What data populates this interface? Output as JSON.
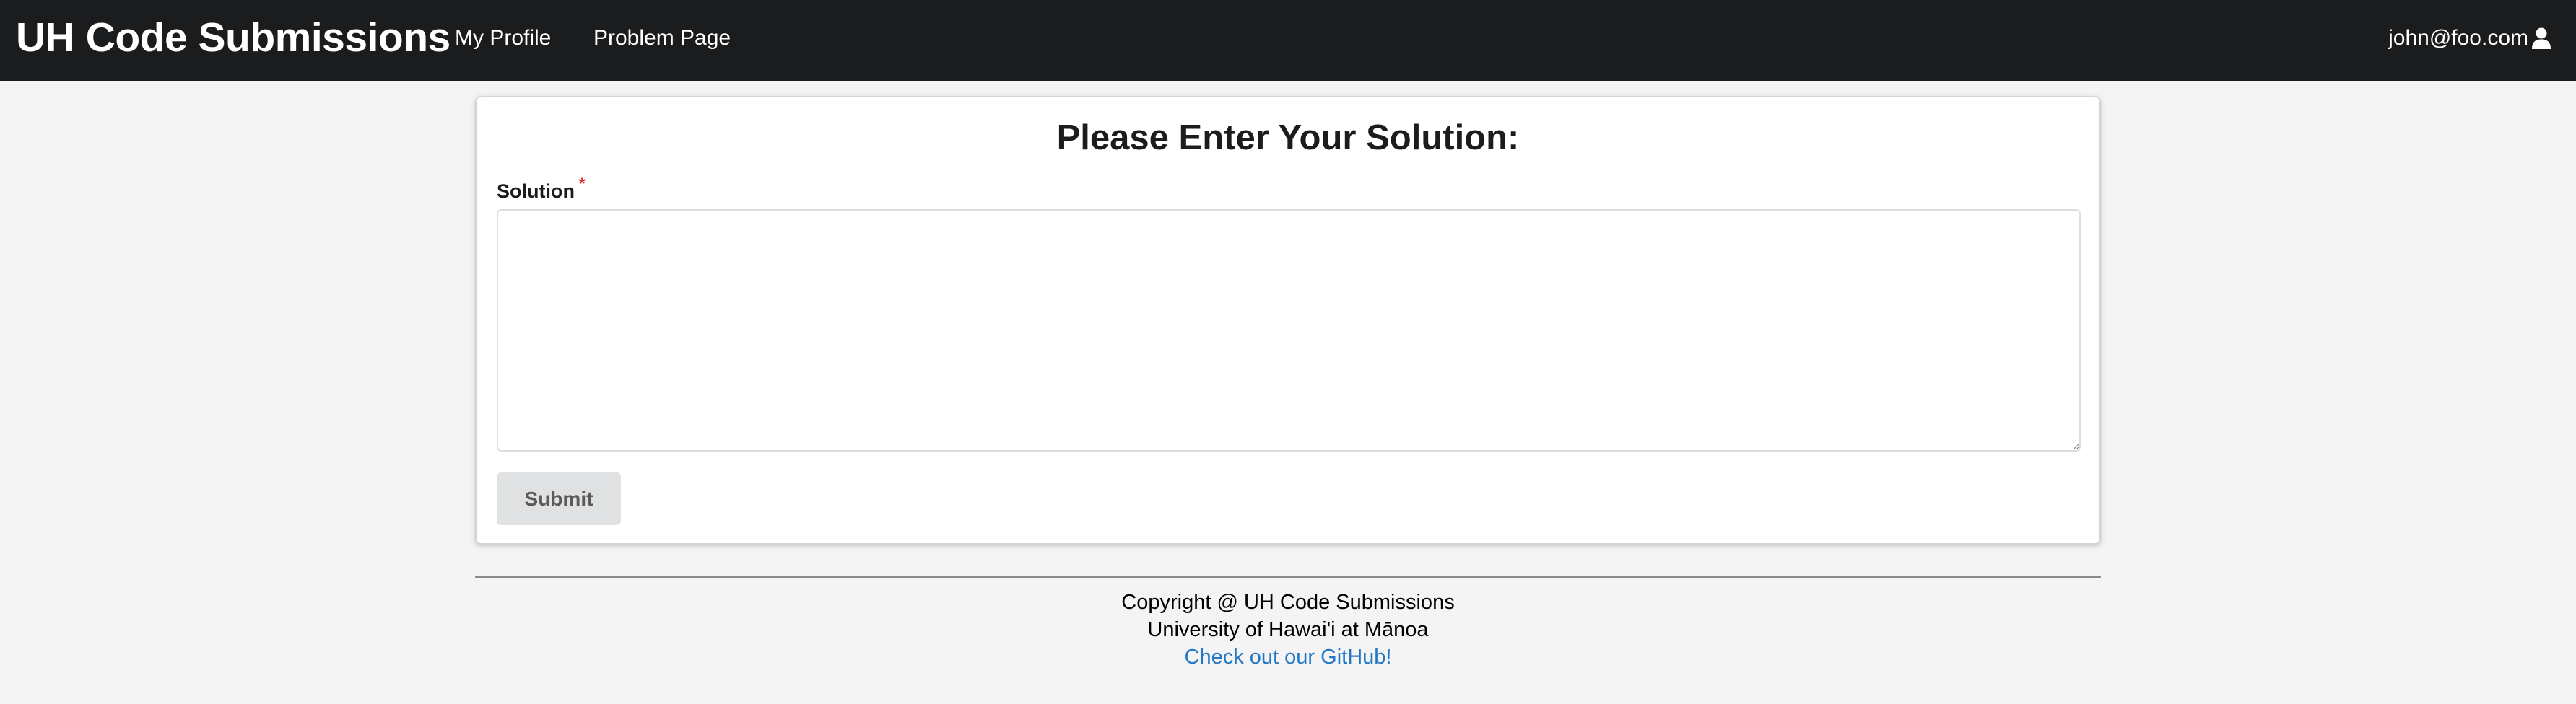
{
  "navbar": {
    "brand": "UH Code Submissions",
    "links": [
      {
        "label": "My Profile"
      },
      {
        "label": "Problem Page"
      }
    ],
    "user": {
      "email": "john@foo.com",
      "icon": "user-icon"
    }
  },
  "form": {
    "title": "Please Enter Your Solution:",
    "solution_label": "Solution",
    "required_marker": "*",
    "solution_value": "",
    "submit_label": "Submit"
  },
  "footer": {
    "copyright": "Copyright @ UH Code Submissions",
    "university": "University of Hawai'i at Mānoa",
    "github_link": "Check out our GitHub!"
  },
  "colors": {
    "navbar_bg": "#1b1c1d",
    "page_bg": "#f4f4f5",
    "link": "#2477c4",
    "required": "#db2828",
    "button_bg": "#e0e1e2"
  }
}
